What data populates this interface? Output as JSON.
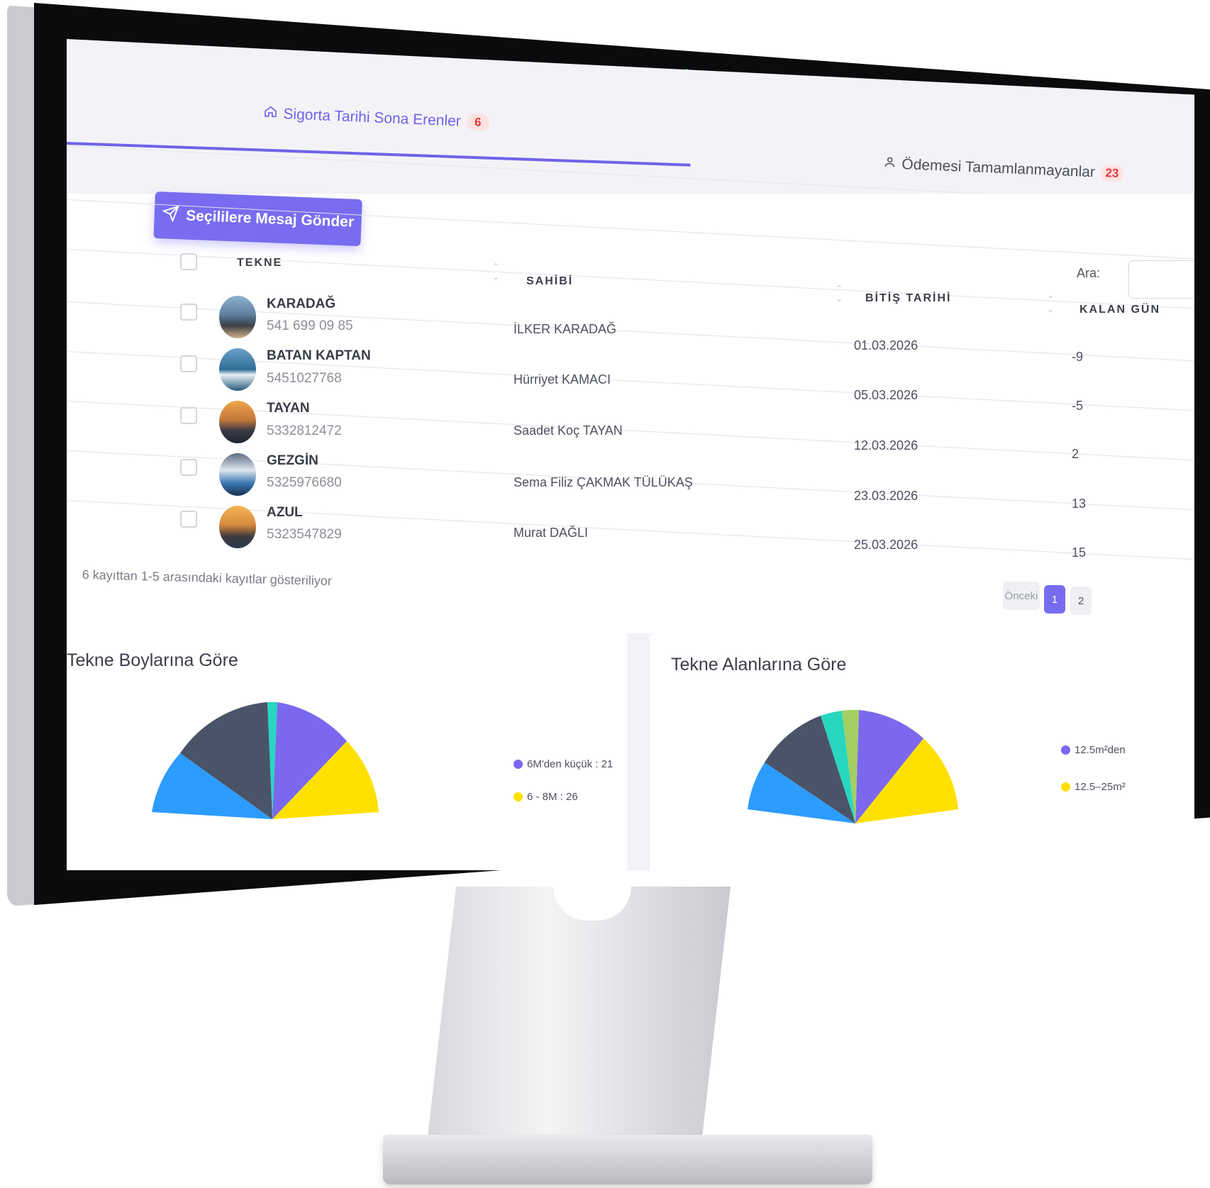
{
  "tabs": [
    {
      "label": "Sigorta Tarihi Sona Erenler",
      "count": "6",
      "icon": "home-icon"
    },
    {
      "label": "Ödemesi Tamamlanmayanlar",
      "count": "23",
      "icon": "user-icon"
    }
  ],
  "toolbar": {
    "send_label": "Seçililere Mesaj Gönder",
    "send_icon": "paper-plane-icon"
  },
  "search": {
    "label": "Ara:",
    "value": ""
  },
  "table": {
    "columns": [
      "TEKNE",
      "SAHİBİ",
      "BİTİŞ TARİHİ",
      "KALAN GÜN"
    ],
    "rows": [
      {
        "name": "KARADAĞ",
        "phone": "541 699 09 85",
        "owner": "İLKER KARADAĞ",
        "end_date": "01.03.2026",
        "days_left": "-9"
      },
      {
        "name": "BATAN KAPTAN",
        "phone": "5451027768",
        "owner": "Hürriyet KAMACI",
        "end_date": "05.03.2026",
        "days_left": "-5"
      },
      {
        "name": "TAYAN",
        "phone": "5332812472",
        "owner": "Saadet Koç TAYAN",
        "end_date": "12.03.2026",
        "days_left": "2"
      },
      {
        "name": "GEZGİN",
        "phone": "5325976680",
        "owner": "Sema Filiz ÇAKMAK TÜLÜKAŞ",
        "end_date": "23.03.2026",
        "days_left": "13"
      },
      {
        "name": "AZUL",
        "phone": "5323547829",
        "owner": "Murat DAĞLI",
        "end_date": "25.03.2026",
        "days_left": "15"
      }
    ]
  },
  "pagination": {
    "info": "6 kayıttan 1-5 arasındaki kayıtlar gösteriliyor",
    "prev": "Önceki",
    "pages": [
      "1",
      "2"
    ],
    "current": "1"
  },
  "colors": {
    "accent": "#786cf0",
    "badge_text": "#e53935",
    "badge_bg": "#fde2e2"
  },
  "chart_data": [
    {
      "type": "pie",
      "title": "Tekne Boylarına Göre",
      "legend_visible": [
        "6M'den küçük : 21",
        "6 - 8M : 26"
      ],
      "slice_colors": [
        "#7b68ee",
        "#ffe100",
        "#2d9cff",
        "#4a5468",
        "#28d7c0"
      ]
    },
    {
      "type": "pie",
      "title": "Tekne Alanlarına Göre",
      "legend_visible": [
        "12.5m²den",
        "12.5–25m²"
      ],
      "slice_colors": [
        "#7b68ee",
        "#ffe100",
        "#2d9cff",
        "#4a5468",
        "#28d7c0",
        "#a3cf62"
      ]
    }
  ]
}
